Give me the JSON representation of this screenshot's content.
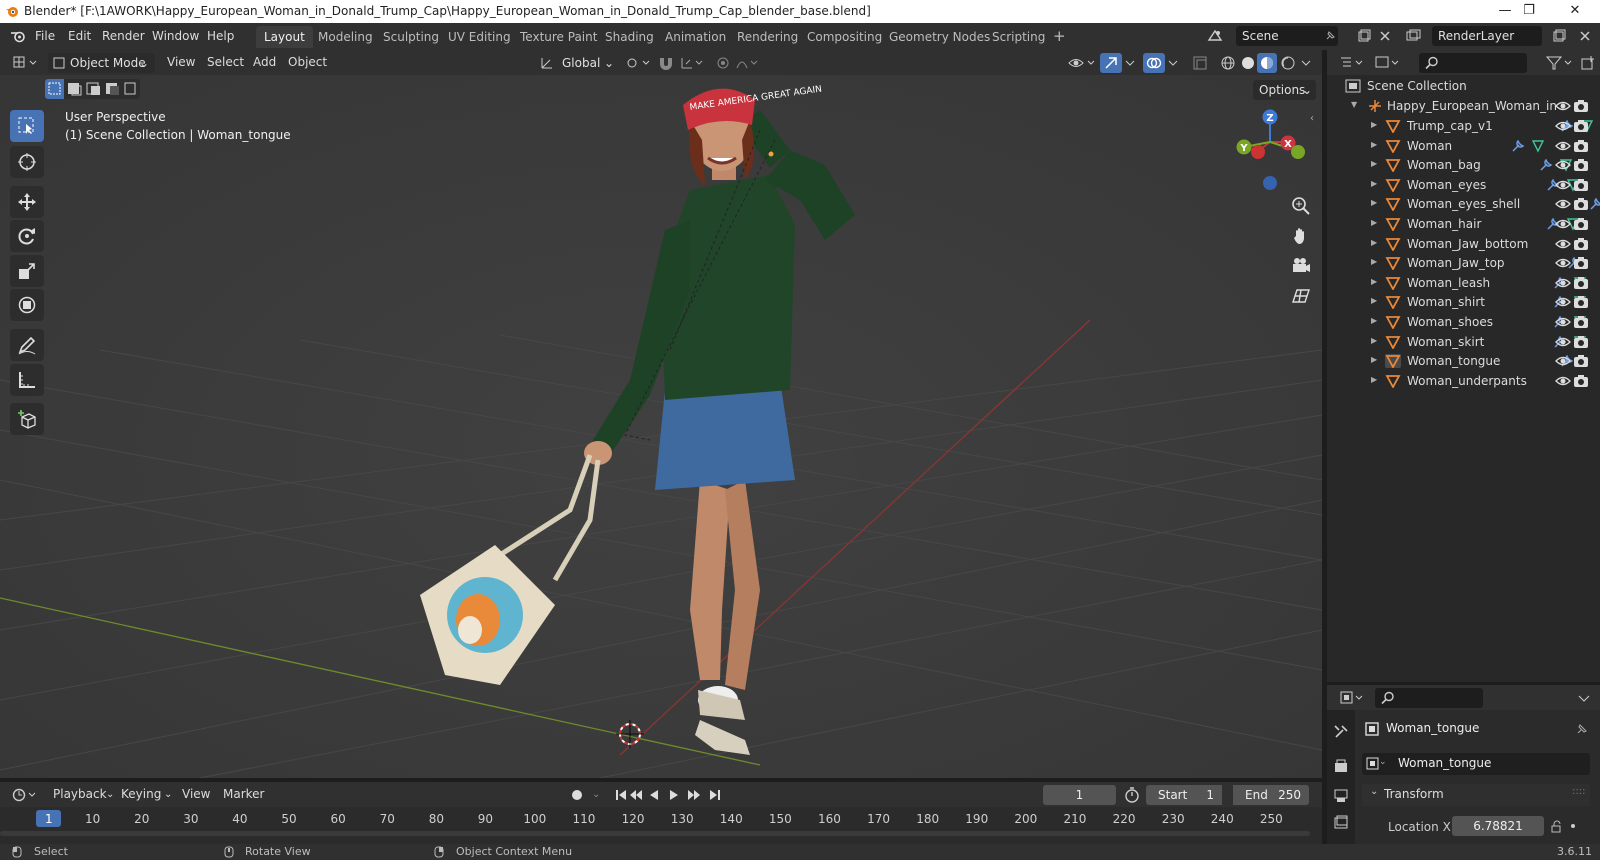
{
  "window": {
    "title": "Blender* [F:\\1AWORK\\Happy_European_Woman_in_Donald_Trump_Cap\\Happy_European_Woman_in_Donald_Trump_Cap_blender_base.blend]"
  },
  "menu": [
    "File",
    "Edit",
    "Render",
    "Window",
    "Help"
  ],
  "workspaces": [
    "Layout",
    "Modeling",
    "Sculpting",
    "UV Editing",
    "Texture Paint",
    "Shading",
    "Animation",
    "Rendering",
    "Compositing",
    "Geometry Nodes",
    "Scripting"
  ],
  "scene": {
    "name": "Scene",
    "render_layer": "RenderLayer"
  },
  "viewport": {
    "mode": "Object Mode",
    "menus": [
      "View",
      "Select",
      "Add",
      "Object"
    ],
    "transform_orientation": "Global",
    "options_label": "Options",
    "overlay_title": "User Perspective",
    "overlay_subtitle": "(1) Scene Collection | Woman_tongue",
    "gizmo": {
      "z": "Z",
      "y": "Y",
      "x": "X"
    },
    "cap_text": "MAKE AMERICA GREAT AGAIN"
  },
  "outliner": {
    "root": "Scene Collection",
    "parent": "Happy_European_Woman_in",
    "items": [
      "Trump_cap_v1",
      "Woman",
      "Woman_bag",
      "Woman_eyes",
      "Woman_eyes_shell",
      "Woman_hair",
      "Woman_Jaw_bottom",
      "Woman_Jaw_top",
      "Woman_leash",
      "Woman_shirt",
      "Woman_shoes",
      "Woman_skirt",
      "Woman_tongue",
      "Woman_underpants"
    ],
    "active": "Woman_tongue"
  },
  "properties": {
    "object_name": "Woman_tongue",
    "data_name": "Woman_tongue",
    "panel": "Transform",
    "location_x_label": "Location X",
    "location_x_value": "6.78821"
  },
  "timeline": {
    "menus": [
      "Playback",
      "Keying",
      "View",
      "Marker"
    ],
    "current_frame": "1",
    "start_label": "Start",
    "start_value": "1",
    "end_label": "End",
    "end_value": "250",
    "ticks": [
      "1",
      "10",
      "20",
      "30",
      "40",
      "50",
      "60",
      "70",
      "80",
      "90",
      "100",
      "110",
      "120",
      "130",
      "140",
      "150",
      "160",
      "170",
      "180",
      "190",
      "200",
      "210",
      "220",
      "230",
      "240",
      "250"
    ]
  },
  "status": {
    "select": "Select",
    "rotate": "Rotate View",
    "context": "Object Context Menu",
    "version": "3.6.11"
  },
  "colors": {
    "accent": "#4772b3",
    "object_orange": "#e8883a",
    "modifier_blue": "#6d9ee8",
    "mesh_green": "#3fc4a0"
  }
}
